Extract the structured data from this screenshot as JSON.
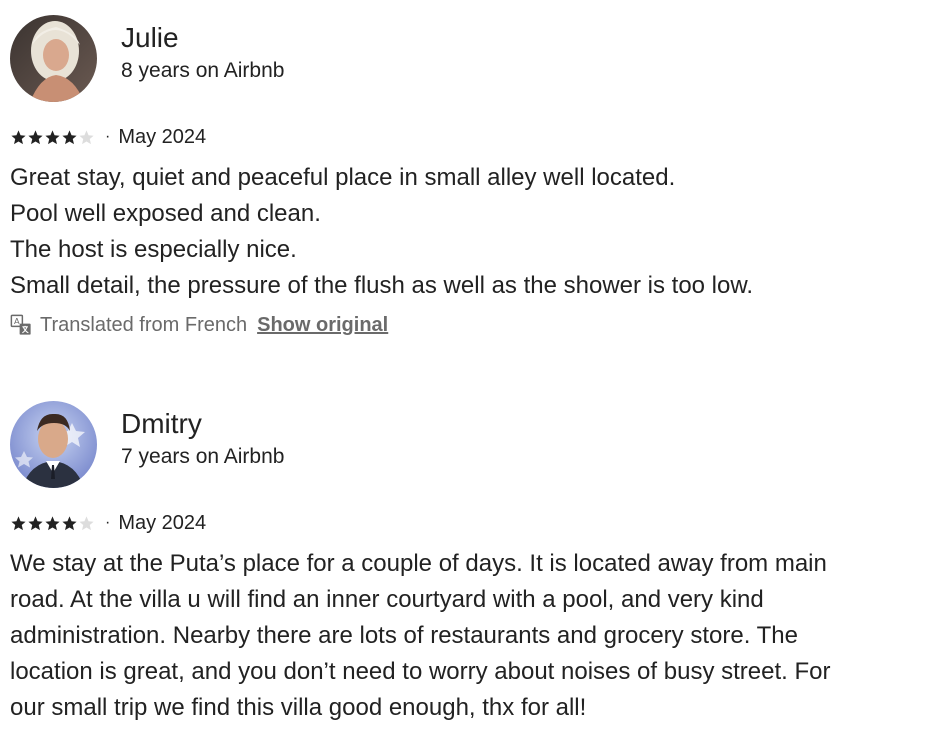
{
  "reviews": [
    {
      "name": "Julie",
      "tenure": "8 years on Airbnb",
      "rating": 4,
      "max_rating": 5,
      "separator": "·",
      "date": "May 2024",
      "body": "Great stay, quiet and peaceful place in small alley well located.\nPool well exposed and clean.\nThe host is especially nice.\nSmall detail, the pressure of the flush as well as the shower is too low.",
      "translated_note": "Translated from French",
      "show_original_label": "Show original"
    },
    {
      "name": "Dmitry",
      "tenure": "7 years on Airbnb",
      "rating": 4,
      "max_rating": 5,
      "separator": "·",
      "date": "May 2024",
      "body": "We stay at the Puta’s place for a couple of days. It is located away from main\nroad. At the villa u will find an inner courtyard with a pool, and very kind\nadministration. Nearby there are lots of restaurants and grocery store. The\nlocation is great, and you don’t need to worry about noises of busy street. For\nour small trip we find this villa good enough, thx for all!"
    }
  ],
  "colors": {
    "text": "#222222",
    "muted": "#6a6a6a",
    "star_filled": "#222222",
    "star_empty": "#dddddd"
  },
  "icons": {
    "star": "star-icon",
    "translate": "translate-icon"
  }
}
